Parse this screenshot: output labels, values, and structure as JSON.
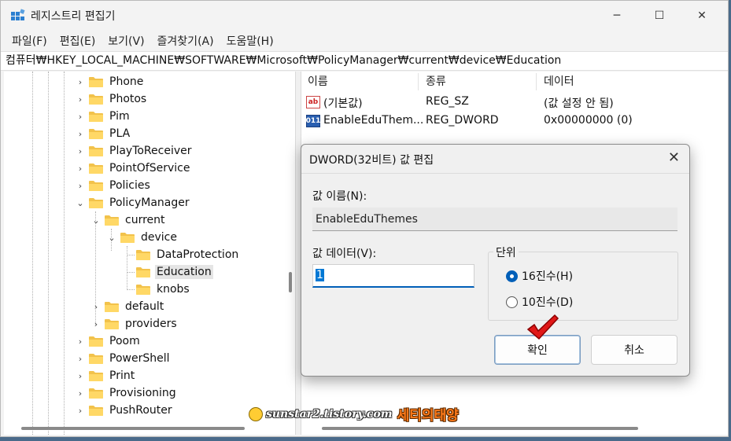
{
  "window": {
    "title": "레지스트리 편집기",
    "minimize": "─",
    "maximize": "☐",
    "close": "✕"
  },
  "menu": [
    "파일(F)",
    "편집(E)",
    "보기(V)",
    "즐겨찾기(A)",
    "도움말(H)"
  ],
  "address": "컴퓨터₩HKEY_LOCAL_MACHINE₩SOFTWARE₩Microsoft₩PolicyManager₩current₩device₩Education",
  "tree": [
    {
      "label": "Phone",
      "chevron": "›"
    },
    {
      "label": "Photos",
      "chevron": "›"
    },
    {
      "label": "Pim",
      "chevron": "›"
    },
    {
      "label": "PLA",
      "chevron": "›"
    },
    {
      "label": "PlayToReceiver",
      "chevron": "›"
    },
    {
      "label": "PointOfService",
      "chevron": "›"
    },
    {
      "label": "Policies",
      "chevron": "›"
    },
    {
      "label": "PolicyManager",
      "chevron": "⌄"
    },
    {
      "label": "current",
      "chevron": "⌄"
    },
    {
      "label": "device",
      "chevron": "⌄"
    },
    {
      "label": "DataProtection",
      "chevron": ""
    },
    {
      "label": "Education",
      "chevron": ""
    },
    {
      "label": "knobs",
      "chevron": ""
    },
    {
      "label": "default",
      "chevron": "›"
    },
    {
      "label": "providers",
      "chevron": "›"
    },
    {
      "label": "Poom",
      "chevron": "›"
    },
    {
      "label": "PowerShell",
      "chevron": "›"
    },
    {
      "label": "Print",
      "chevron": "›"
    },
    {
      "label": "Provisioning",
      "chevron": "›"
    },
    {
      "label": "PushRouter",
      "chevron": "›"
    }
  ],
  "list": {
    "headers": [
      "이름",
      "종류",
      "데이터"
    ],
    "rows": [
      {
        "icon": "ab",
        "name": "(기본값)",
        "type": "REG_SZ",
        "data": "(값 설정 안 됨)"
      },
      {
        "icon": "011",
        "name": "EnableEduThem...",
        "type": "REG_DWORD",
        "data": "0x00000000 (0)"
      }
    ]
  },
  "dialog": {
    "title": "DWORD(32비트) 값 편집",
    "close": "✕",
    "name_label": "값 이름(N):",
    "name_value": "EnableEduThemes",
    "data_label": "값 데이터(V):",
    "data_value": "1",
    "base_label": "단위",
    "radio_hex": "16진수(H)",
    "radio_dec": "10진수(D)",
    "ok": "확인",
    "cancel": "취소"
  },
  "watermark": {
    "url": "sunstar2.tistory.com",
    "name": "세티의태양"
  }
}
